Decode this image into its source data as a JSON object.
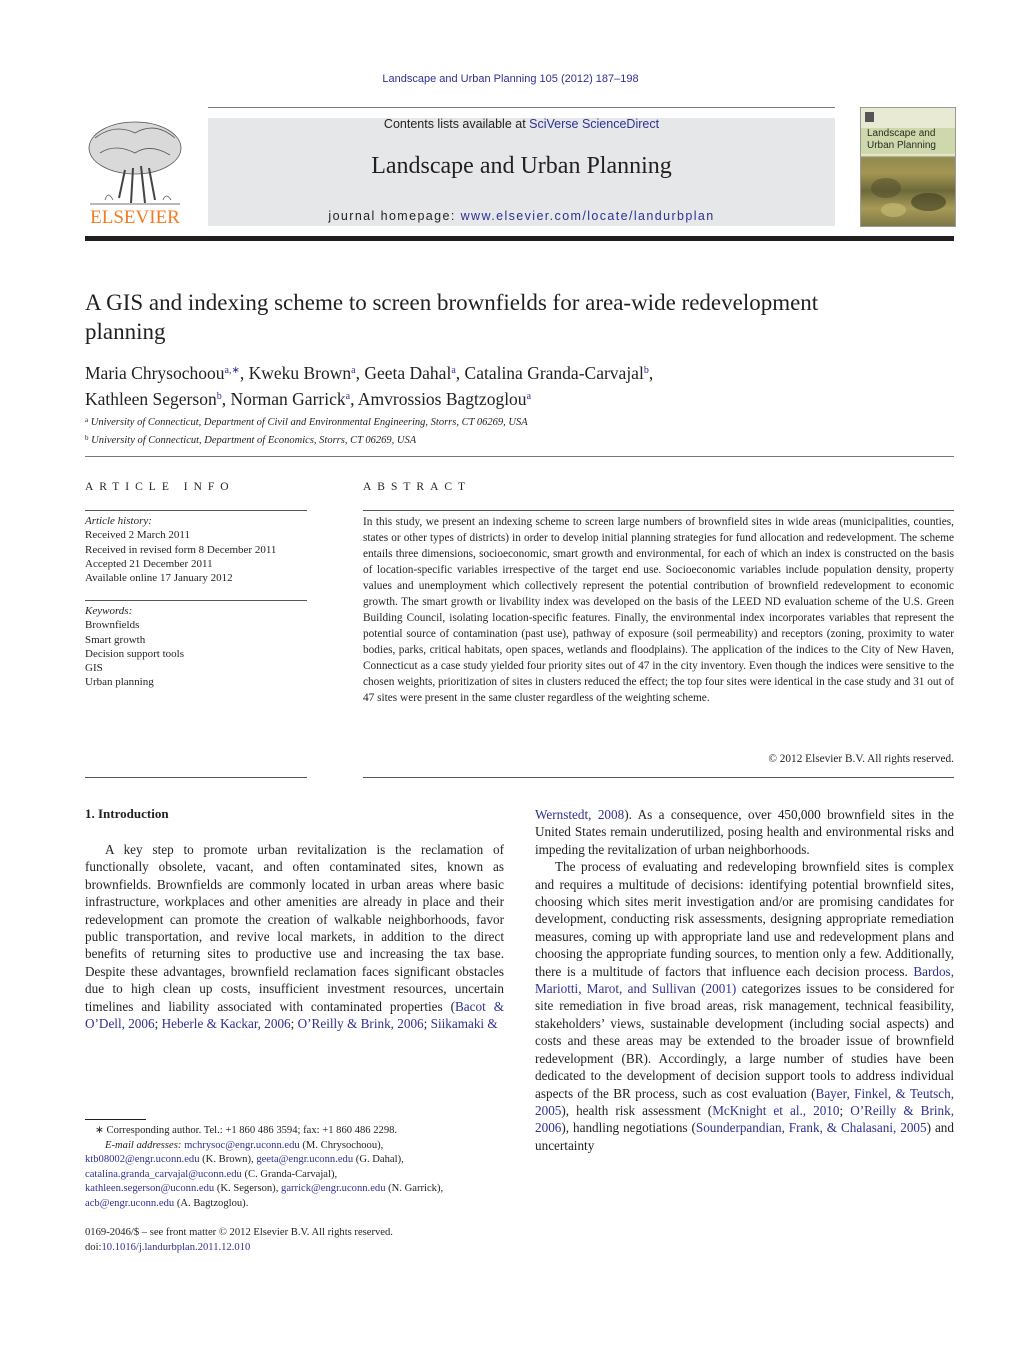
{
  "header": {
    "journal_ref": "Landscape and Urban Planning 105 (2012) 187–198",
    "contents_prefix": "Contents lists available at ",
    "contents_link": "SciVerse ScienceDirect",
    "journal_title": "Landscape and Urban Planning",
    "homepage_prefix": "journal homepage: ",
    "homepage_link": "www.elsevier.com/locate/landurbplan",
    "publisher_logo_text": "ELSEVIER",
    "cover_title_line1": "Landscape and",
    "cover_title_line2": "Urban Planning"
  },
  "colors": {
    "link": "#2e3192",
    "elsevier_orange": "#f47b20",
    "banner_bg": "#e6e7e8",
    "text": "#231f20"
  },
  "article": {
    "title": "A GIS and indexing scheme to screen brownfields for area-wide redevelopment planning",
    "authors": [
      {
        "name": "Maria Chrysochoou",
        "sup": "a,∗"
      },
      {
        "name": "Kweku Brown",
        "sup": "a"
      },
      {
        "name": "Geeta Dahal",
        "sup": "a"
      },
      {
        "name": "Catalina Granda-Carvajal",
        "sup": "b"
      },
      {
        "name": "Kathleen Segerson",
        "sup": "b"
      },
      {
        "name": "Norman Garrick",
        "sup": "a"
      },
      {
        "name": "Amvrossios Bagtzoglou",
        "sup": "a"
      }
    ],
    "affiliations": [
      {
        "key": "a",
        "text": "University of Connecticut, Department of Civil and Environmental Engineering, Storrs, CT 06269, USA"
      },
      {
        "key": "b",
        "text": "University of Connecticut, Department of Economics, Storrs, CT 06269, USA"
      }
    ]
  },
  "article_info": {
    "heading": "ARTICLE INFO",
    "history_label": "Article history:",
    "history": [
      "Received 2 March 2011",
      "Received in revised form 8 December 2011",
      "Accepted 21 December 2011",
      "Available online 17 January 2012"
    ],
    "keywords_label": "Keywords:",
    "keywords": [
      "Brownfields",
      "Smart growth",
      "Decision support tools",
      "GIS",
      "Urban planning"
    ]
  },
  "abstract": {
    "heading": "ABSTRACT",
    "text": "In this study, we present an indexing scheme to screen large numbers of brownfield sites in wide areas (municipalities, counties, states or other types of districts) in order to develop initial planning strategies for fund allocation and redevelopment. The scheme entails three dimensions, socioeconomic, smart growth and environmental, for each of which an index is constructed on the basis of location-specific variables irrespective of the target end use. Socioeconomic variables include population density, property values and unemployment which collectively represent the potential contribution of brownfield redevelopment to economic growth. The smart growth or livability index was developed on the basis of the LEED ND evaluation scheme of the U.S. Green Building Council, isolating location-specific features. Finally, the environmental index incorporates variables that represent the potential source of contamination (past use), pathway of exposure (soil permeability) and receptors (zoning, proximity to water bodies, parks, critical habitats, open spaces, wetlands and floodplains). The application of the indices to the City of New Haven, Connecticut as a case study yielded four priority sites out of 47 in the city inventory. Even though the indices were sensitive to the chosen weights, prioritization of sites in clusters reduced the effect; the top four sites were identical in the case study and 31 out of 47 sites were present in the same cluster regardless of the weighting scheme.",
    "copyright": "© 2012 Elsevier B.V. All rights reserved."
  },
  "body": {
    "section_heading": "1.  Introduction",
    "p1_text": "A key step to promote urban revitalization is the reclamation of functionally obsolete, vacant, and often contaminated sites, known as brownfields. Brownfields are commonly located in urban areas where basic infrastructure, workplaces and other amenities are already in place and their redevelopment can promote the creation of walkable neighborhoods, favor public transportation, and revive local markets, in addition to the direct benefits of returning sites to productive use and increasing the tax base. Despite these advantages, brownfield reclamation faces significant obstacles due to high clean up costs, insufficient investment resources, uncertain timelines and liability associated with contaminated properties (",
    "p1_cite1": "Bacot & O’Dell, 2006",
    "p1_cite2": "Heberle & Kackar, 2006",
    "p1_cite3": "O’Reilly & Brink, 2006",
    "p1_cite4": "Siikamaki & Wernstedt, 2008",
    "p1_cite4_part1": "Siikamaki &",
    "p1_cite4_part2": "Wernstedt, 2008",
    "p1_tail": "). As a consequence, over 450,000 brownfield sites in the United States remain underutilized, posing health and environmental risks and impeding the revitalization of urban neighborhoods.",
    "p2_text1": "The process of evaluating and redeveloping brownfield sites is complex and requires a multitude of decisions: identifying potential brownfield sites, choosing which sites merit investigation and/or are promising candidates for development, conducting risk assessments, designing appropriate remediation measures, coming up with appropriate land use and redevelopment plans and choosing the appropriate funding sources, to mention only a few. Additionally, there is a multitude of factors that influence each decision process. ",
    "p2_cite1": "Bardos, Mariotti, Marot, and Sullivan (2001)",
    "p2_text2": " categorizes issues to be considered for site remediation in five broad areas, risk management, technical feasibility, stakeholders’ views, sustainable development (including social aspects) and costs and these areas may be extended to the broader issue of brownfield redevelopment (BR). Accordingly, a large number of studies have been dedicated to the development of decision support tools to address individual aspects of the BR process, such as cost evaluation (",
    "p2_cite2": "Bayer, Finkel, & Teutsch, 2005",
    "p2_text3": "), health risk assessment (",
    "p2_cite3": "McKnight et al., 2010",
    "p2_cite4": "O’Reilly & Brink, 2006",
    "p2_text4": "), handling negotiations (",
    "p2_cite5": "Sounderpandian, Frank, & Chalasani, 2005",
    "p2_text5": ") and uncertainty"
  },
  "footnotes": {
    "corresponding": "∗  Corresponding author. Tel.: +1 860 486 3594; fax: +1 860 486 2298.",
    "email_label": "E-mail addresses:",
    "emails": [
      {
        "email": "mchrysoc@engr.uconn.edu",
        "name": "(M. Chrysochoou),"
      },
      {
        "email": "ktb08002@engr.uconn.edu",
        "name": "(K. Brown),"
      },
      {
        "email": "geeta@engr.uconn.edu",
        "name": "(G. Dahal),"
      },
      {
        "email": "catalina.granda_carvajal@uconn.edu",
        "name": "(C. Granda-Carvajal),"
      },
      {
        "email": "kathleen.segerson@uconn.edu",
        "name": "(K. Segerson),"
      },
      {
        "email": "garrick@engr.uconn.edu",
        "name": "(N. Garrick),"
      },
      {
        "email": "acb@engr.uconn.edu",
        "name": "(A. Bagtzoglou)."
      }
    ],
    "front_matter": "0169-2046/$ – see front matter © 2012 Elsevier B.V. All rights reserved.",
    "doi_prefix": "doi:",
    "doi": "10.1016/j.landurbplan.2011.12.010"
  }
}
